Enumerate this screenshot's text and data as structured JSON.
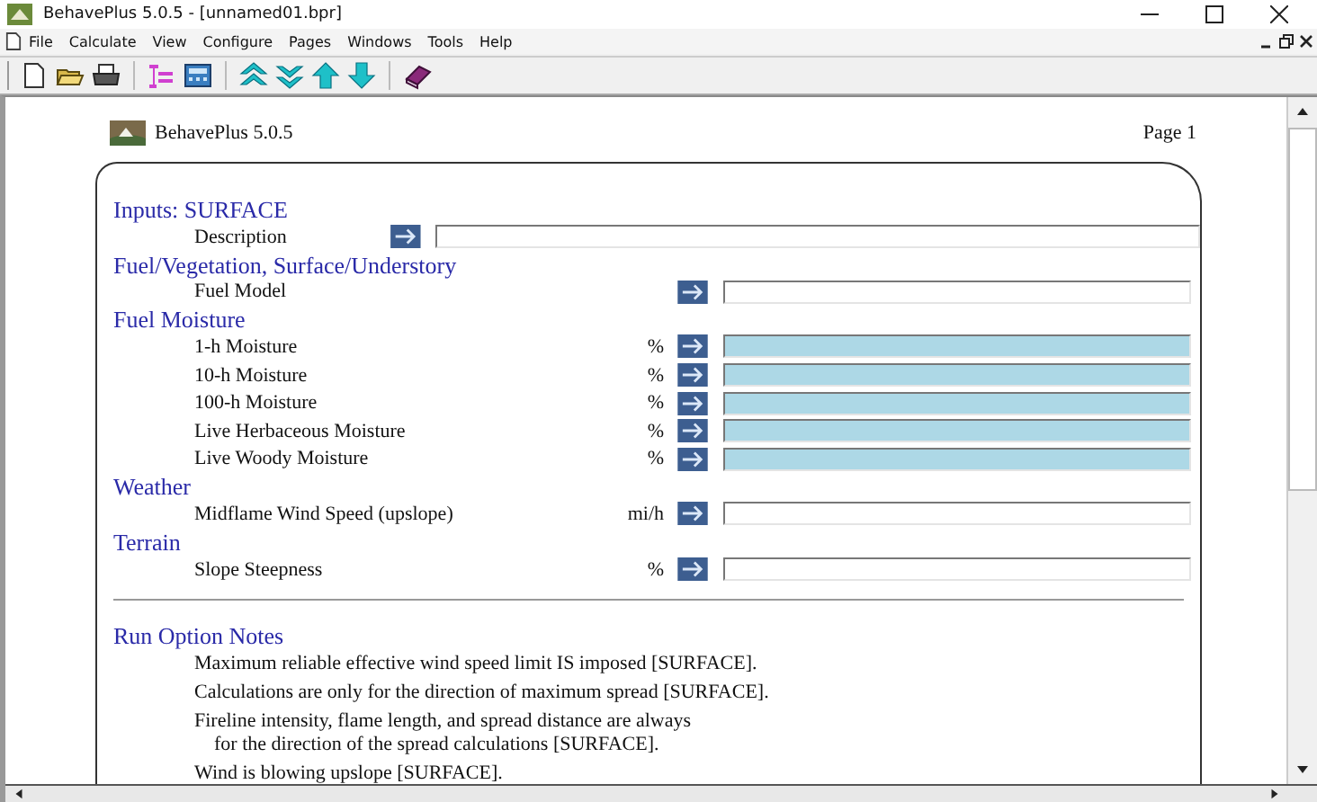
{
  "window": {
    "title": "BehavePlus 5.0.5 - [unnamed01.bpr]"
  },
  "menu": [
    "File",
    "Calculate",
    "View",
    "Configure",
    "Pages",
    "Windows",
    "Tools",
    "Help"
  ],
  "page": {
    "app_name": "BehavePlus 5.0.5",
    "page_label": "Page 1",
    "sections": [
      {
        "heading": "Inputs: SURFACE",
        "rows": [
          {
            "kind": "description",
            "label": "Description",
            "units": "",
            "highlighted": false
          }
        ]
      },
      {
        "heading": "Fuel/Vegetation, Surface/Understory",
        "rows": [
          {
            "kind": "input",
            "label": "Fuel Model",
            "units": "",
            "highlighted": false
          }
        ]
      },
      {
        "heading": "Fuel Moisture",
        "rows": [
          {
            "kind": "input",
            "label": "1-h Moisture",
            "units": "%",
            "highlighted": true
          },
          {
            "kind": "input",
            "label": "10-h Moisture",
            "units": "%",
            "highlighted": true
          },
          {
            "kind": "input",
            "label": "100-h Moisture",
            "units": "%",
            "highlighted": true
          },
          {
            "kind": "input",
            "label": "Live Herbaceous Moisture",
            "units": "%",
            "highlighted": true
          },
          {
            "kind": "input",
            "label": "Live Woody Moisture",
            "units": "%",
            "highlighted": true
          }
        ]
      },
      {
        "heading": "Weather",
        "rows": [
          {
            "kind": "input",
            "label": "Midflame Wind Speed (upslope)",
            "units": "mi/h",
            "highlighted": false
          }
        ]
      },
      {
        "heading": "Terrain",
        "rows": [
          {
            "kind": "input",
            "label": "Slope Steepness",
            "units": "%",
            "highlighted": false
          }
        ]
      }
    ],
    "notes_heading": "Run Option Notes",
    "notes": [
      {
        "lines": [
          "Maximum reliable effective wind speed limit IS imposed [SURFACE]."
        ]
      },
      {
        "lines": [
          "Calculations are only for the direction of maximum spread [SURFACE]."
        ]
      },
      {
        "lines": [
          "Fireline intensity, flame length, and spread distance are always",
          "for the direction of the spread calculations [SURFACE]."
        ]
      },
      {
        "lines": [
          "Wind is blowing upslope [SURFACE]."
        ]
      }
    ]
  }
}
